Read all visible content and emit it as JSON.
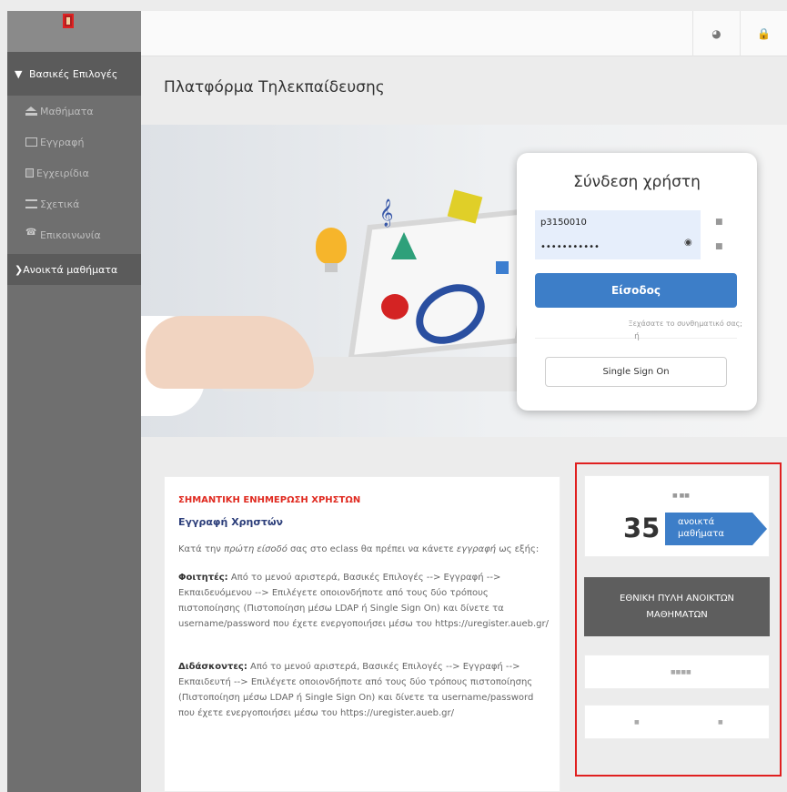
{
  "sidebar": {
    "section_main": "Βασικές Επιλογές",
    "items": [
      {
        "label": "Μαθήματα",
        "icon": "graduation-cap-icon"
      },
      {
        "label": "Εγγραφή",
        "icon": "edit-icon"
      },
      {
        "label": "Εγχειρίδια",
        "icon": "document-icon"
      },
      {
        "label": "Σχετικά",
        "icon": "list-icon"
      },
      {
        "label": "Επικοινωνία",
        "icon": "phone-icon"
      }
    ],
    "section_open": "Ανοικτά μαθήματα"
  },
  "topbar": {
    "globe_icon": "globe-icon",
    "lock_icon": "lock-icon"
  },
  "page_title": "Πλατφόρμα Τηλεκπαίδευσης",
  "login": {
    "title": "Σύνδεση χρήστη",
    "username_value": "p3150010",
    "password_value": "•••••••••••",
    "login_button": "Είσοδος",
    "forgot_link": "Ξεχάσατε το συνθηματικό σας;",
    "or_text": "ή",
    "sso_button": "Single Sign On"
  },
  "announcement": {
    "title": "ΣΗΜΑΝΤΙΚΗ ΕΝΗΜΕΡΩΣΗ ΧΡΗΣΤΩΝ",
    "subtitle": "Εγγραφή Χρηστών",
    "intro_a": "Κατά την ",
    "intro_em1": "πρώτη είσοδό",
    "intro_b": " σας στο eclass θα πρέπει να κάνετε ",
    "intro_em2": "εγγραφή",
    "intro_c": " ως εξής:",
    "students_label": "Φοιτητές:",
    "students_text": " Από το μενού αριστερά, Βασικές Επιλογές --> Εγγραφή --> Εκπαιδευόμενου --> Επιλέγετε οποιονδήποτε από τους δύο τρόπους πιστοποίησης (Πιστοποίηση μέσω LDAP ή Single Sign On) και δίνετε τα username/password  που έχετε ενεργοποιήσει μέσω του https://uregister.aueb.gr/",
    "teachers_label": "Διδάσκοντες:",
    "teachers_text": " Από το μενού αριστερά, Βασικές Επιλογές --> Εγγραφή --> Εκπαιδευτή --> Επιλέγετε οποιονδήποτε από τους δύο τρόπους πιστοποίησης (Πιστοποίηση μέσω LDAP ή Single Sign On) και δίνετε τα username/password  που έχετε ενεργοποιήσει μέσω του https://uregister.aueb.gr/"
  },
  "stats": {
    "dots": "■ ■■",
    "count": "35",
    "tag_line1": "ανοικτά",
    "tag_line2": "μαθήματα"
  },
  "national_portal": "ΕΘΝΙΚΗ ΠΥΛΗ ΑΝΟΙΚΤΩΝ ΜΑΘΗΜΑΤΩΝ",
  "placeholder_1": "■■■■",
  "placeholder_2a": "■",
  "placeholder_2b": "■"
}
